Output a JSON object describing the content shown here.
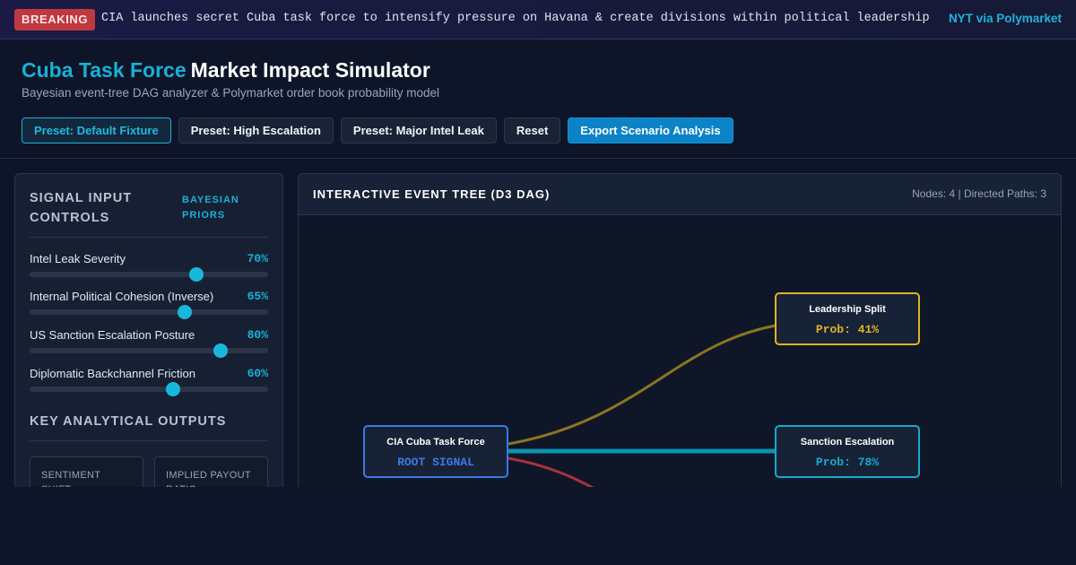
{
  "ticker": {
    "badge": "BREAKING",
    "headline": "CIA launches secret Cuba task force to intensify pressure on Havana & create divisions within political leadership",
    "source": "NYT via Polymarket"
  },
  "header": {
    "title_highlight": "Cuba Task Force",
    "title_rest": "Market Impact Simulator",
    "subtitle": "Bayesian event-tree DAG analyzer & Polymarket order book probability model"
  },
  "toolbar": {
    "preset_default": "Preset: Default Fixture",
    "preset_escalation": "Preset: High Escalation",
    "preset_leak": "Preset: Major Intel Leak",
    "reset": "Reset",
    "export": "Export Scenario Analysis"
  },
  "controls": {
    "title": "SIGNAL INPUT CONTROLS",
    "tag": "BAYESIAN PRIORS",
    "sliders": [
      {
        "label": "Intel Leak Severity",
        "value": 70,
        "display": "70%"
      },
      {
        "label": "Internal Political Cohesion (Inverse)",
        "value": 65,
        "display": "65%"
      },
      {
        "label": "US Sanction Escalation Posture",
        "value": 80,
        "display": "80%"
      },
      {
        "label": "Diplomatic Backchannel Friction",
        "value": 60,
        "display": "60%"
      }
    ],
    "outputs_title": "KEY ANALYTICAL OUTPUTS",
    "outputs": [
      {
        "label": "SENTIMENT SHIFT"
      },
      {
        "label": "IMPLIED PAYOUT RATIO"
      }
    ]
  },
  "tree": {
    "title": "INTERACTIVE EVENT TREE (D3 DAG)",
    "meta": "Nodes: 4 | Directed Paths: 3",
    "nodes": [
      {
        "id": "root",
        "label": "CIA Cuba Task Force",
        "sub": "ROOT SIGNAL",
        "color": "#3b78e6"
      },
      {
        "id": "split",
        "label": "Leadership Split",
        "sub": "Prob: 41%",
        "color": "#e0b324"
      },
      {
        "id": "sanction",
        "label": "Sanction Escalation",
        "sub": "Prob: 78%",
        "color": "#18a9cf"
      }
    ],
    "edge_colors": {
      "split": "#8a7523",
      "sanction": "#0e93ad",
      "third": "#a7323d"
    }
  }
}
